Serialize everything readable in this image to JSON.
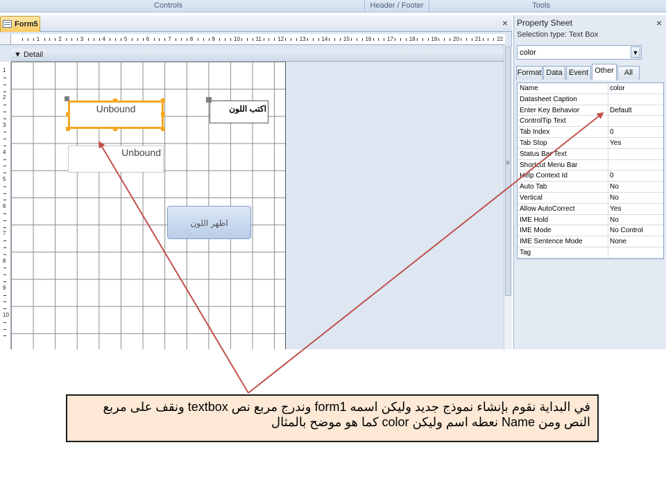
{
  "ribbon": {
    "group_controls": "Controls",
    "group_header_footer": "Header / Footer",
    "group_tools": "Tools"
  },
  "form_window": {
    "tab_label": "Form5",
    "close_glyph": "×",
    "section_label": "Detail",
    "section_icon": "chevron-down-icon",
    "ruler_numbers": [
      "1",
      "2",
      "3",
      "4",
      "5",
      "6",
      "7",
      "8",
      "9",
      "10",
      "11",
      "12",
      "13",
      "14",
      "15",
      "16",
      "17",
      "18",
      "19",
      "20",
      "21",
      "22"
    ],
    "vruler_numbers": [
      "1",
      "2",
      "3",
      "4",
      "5",
      "6",
      "7",
      "8",
      "9",
      "10"
    ]
  },
  "controls": {
    "textbox1_text": "Unbound",
    "textbox2_text": "Unbound",
    "label1_text": "اكتب اللون",
    "button1_text": "اظهر اللون"
  },
  "property_sheet": {
    "title": "Property Sheet",
    "close_glyph": "×",
    "selection_type": "Selection type:  Text Box",
    "combo_value": "color",
    "tabs": [
      "Format",
      "Data",
      "Event",
      "Other",
      "All"
    ],
    "active_tab": "Other",
    "rows": [
      {
        "k": "Name",
        "v": "color"
      },
      {
        "k": "Datasheet Caption",
        "v": ""
      },
      {
        "k": "Enter Key Behavior",
        "v": "Default"
      },
      {
        "k": "ControlTip Text",
        "v": ""
      },
      {
        "k": "Tab Index",
        "v": "0"
      },
      {
        "k": "Tab Stop",
        "v": "Yes"
      },
      {
        "k": "Status Bar Text",
        "v": ""
      },
      {
        "k": "Shortcut Menu Bar",
        "v": ""
      },
      {
        "k": "Help Context Id",
        "v": "0"
      },
      {
        "k": "Auto Tab",
        "v": "No"
      },
      {
        "k": "Vertical",
        "v": "No"
      },
      {
        "k": "Allow AutoCorrect",
        "v": "Yes"
      },
      {
        "k": "IME Hold",
        "v": "No"
      },
      {
        "k": "IME Mode",
        "v": "No Control"
      },
      {
        "k": "IME Sentence Mode",
        "v": "None"
      },
      {
        "k": "Tag",
        "v": ""
      }
    ]
  },
  "callout": {
    "text": "في البداية نقوم بإنشاء نموذج جديد وليكن اسمه form1 وندرج مربع نص textbox ونقف على مربع النص ومن Name نعطه اسم وليكن color كما هو موضح بالمثال"
  },
  "colors": {
    "selected_border": "#f5a623",
    "arrow": "#c0504d",
    "callout_fill": "#fde9d6"
  }
}
